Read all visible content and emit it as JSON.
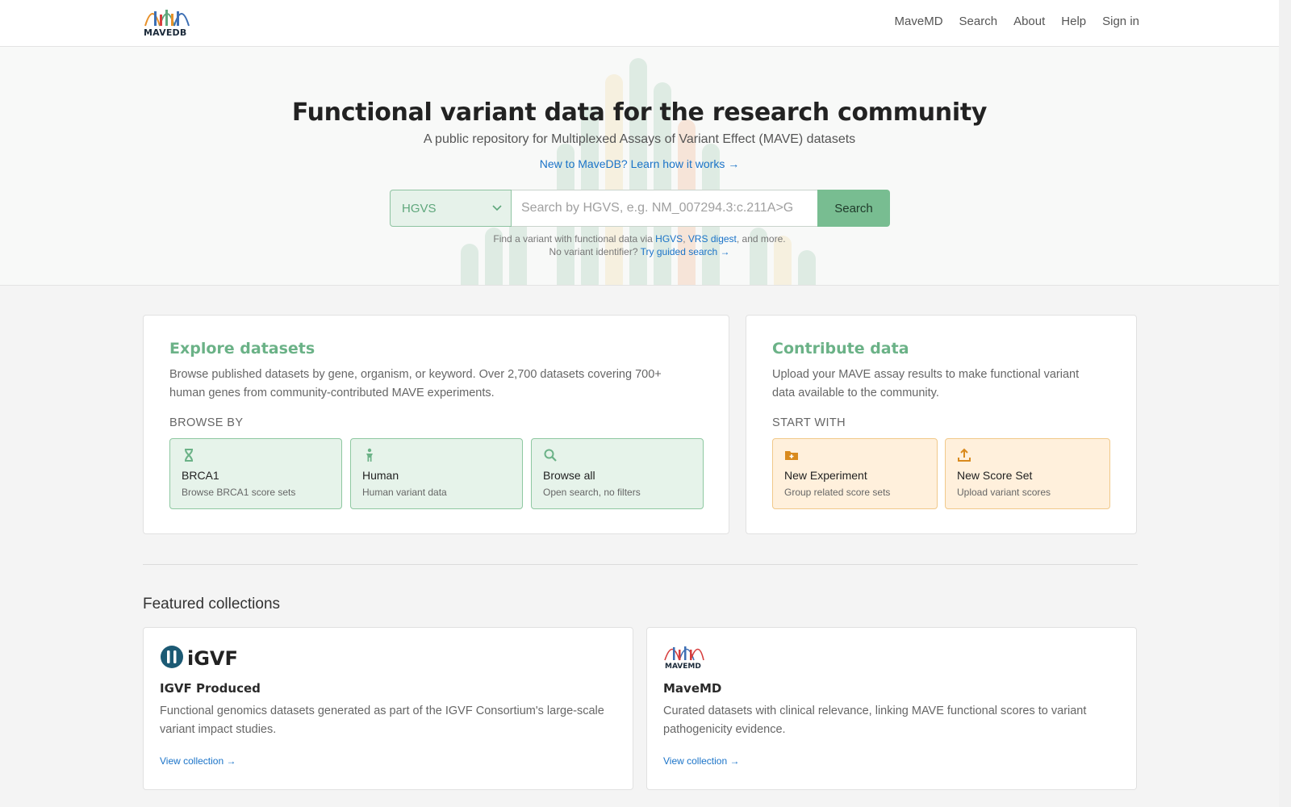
{
  "header": {
    "logo_text": "MAVEDB",
    "nav": [
      "MaveMD",
      "Search",
      "About",
      "Help",
      "Sign in"
    ]
  },
  "hero": {
    "title": "Functional variant data for the research community",
    "subtitle": "A public repository for Multiplexed Assays of Variant Effect (MAVE) datasets",
    "learn_link": "New to MaveDB? Learn how it works →",
    "search": {
      "type_selected": "HGVS",
      "placeholder": "Search by HGVS, e.g. NM_007294.3:c.211A>G",
      "button": "Search"
    },
    "hint1_prefix": "Find a variant with functional data via ",
    "hint1_link1": "HGVS",
    "hint1_sep": ", ",
    "hint1_link2": "VRS digest",
    "hint1_suffix": ", and more.",
    "hint2_prefix": "No variant identifier? ",
    "hint2_link": "Try guided search →"
  },
  "explore": {
    "title": "Explore datasets",
    "description": "Browse published datasets by gene, organism, or keyword. Over 2,700 datasets covering 700+ human genes from community-contributed MAVE experiments.",
    "browse_label": "BROWSE BY",
    "tiles": [
      {
        "title": "BRCA1",
        "subtitle": "Browse BRCA1 score sets",
        "icon": "dna-icon"
      },
      {
        "title": "Human",
        "subtitle": "Human variant data",
        "icon": "person-icon"
      },
      {
        "title": "Browse all",
        "subtitle": "Open search, no filters",
        "icon": "search-icon"
      }
    ]
  },
  "contribute": {
    "title": "Contribute data",
    "description": "Upload your MAVE assay results to make functional variant data available to the community.",
    "start_label": "START WITH",
    "tiles": [
      {
        "title": "New Experiment",
        "subtitle": "Group related score sets",
        "icon": "folder-plus-icon"
      },
      {
        "title": "New Score Set",
        "subtitle": "Upload variant scores",
        "icon": "upload-icon"
      }
    ]
  },
  "featured": {
    "title": "Featured collections",
    "collections": [
      {
        "logo_text": "iGVF",
        "name": "IGVF Produced",
        "description": "Functional genomics datasets generated as part of the IGVF Consortium's large-scale variant impact studies.",
        "link": "View collection →"
      },
      {
        "logo_text": "MAVEMD",
        "name": "MaveMD",
        "description": "Curated datasets with clinical relevance, linking MAVE functional scores to variant pathogenicity evidence.",
        "link": "View collection →"
      }
    ]
  },
  "colors": {
    "accent_green": "#6bb287",
    "accent_orange": "#d98a1e",
    "link_blue": "#1a73c8"
  }
}
